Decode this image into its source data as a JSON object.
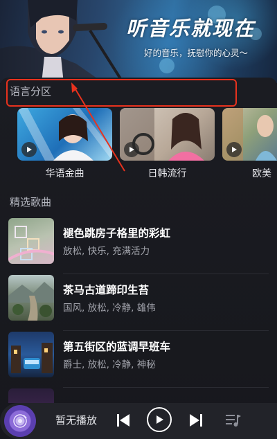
{
  "banner": {
    "title": "听音乐就现在",
    "subtitle": "好的音乐，抚慰你的心灵～"
  },
  "language_section": {
    "title": "语言分区",
    "items": [
      {
        "label": "华语金曲"
      },
      {
        "label": "日韩流行"
      },
      {
        "label": "欧美"
      }
    ]
  },
  "featured_section": {
    "title": "精选歌曲",
    "songs": [
      {
        "title": "褪色跳房子格里的彩虹",
        "tags": "放松, 快乐, 充满活力"
      },
      {
        "title": "茶马古道蹄印生苔",
        "tags": "国风, 放松, 冷静, 雄伟"
      },
      {
        "title": "第五街区的蓝调早班车",
        "tags": "爵士, 放松, 冷静, 神秘"
      }
    ]
  },
  "player": {
    "now_playing": "暂无播放"
  },
  "colors": {
    "highlight": "#e8321e",
    "background": "#17181d"
  }
}
